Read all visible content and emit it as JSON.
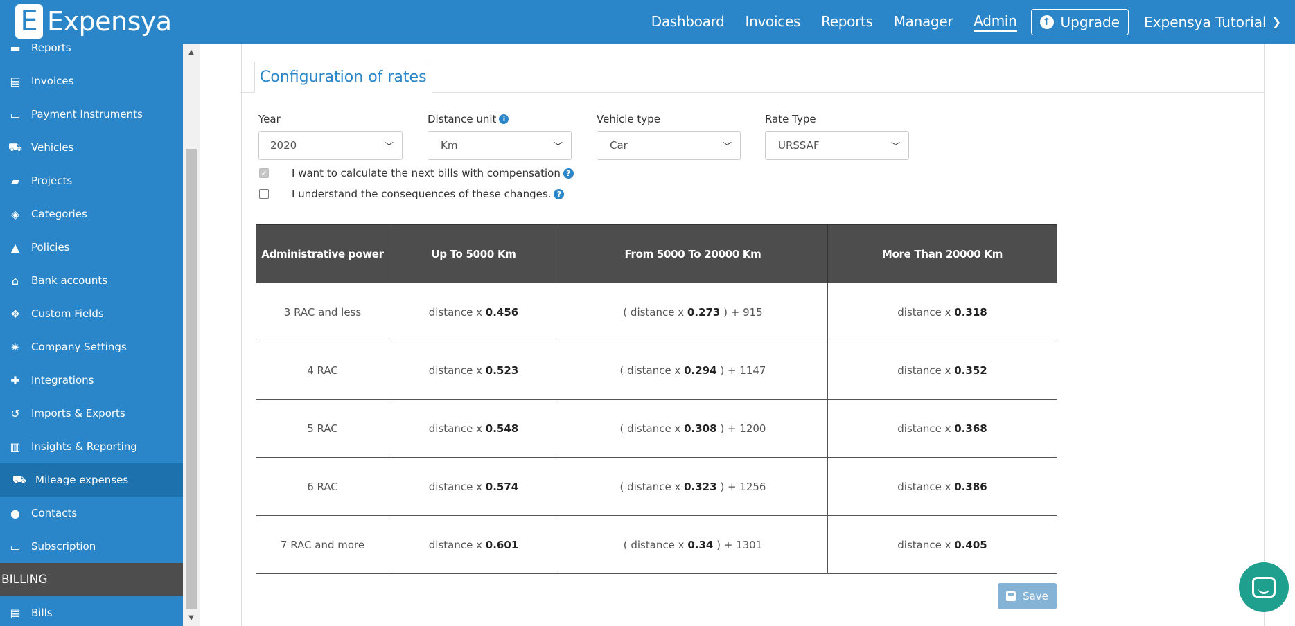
{
  "brand": {
    "logo_letter": "E",
    "name": "Expensya"
  },
  "nav": {
    "items": [
      {
        "label": "Dashboard",
        "active": false
      },
      {
        "label": "Invoices",
        "active": false
      },
      {
        "label": "Reports",
        "active": false
      },
      {
        "label": "Manager",
        "active": false
      },
      {
        "label": "Admin",
        "active": true
      }
    ],
    "upgrade_label": "Upgrade",
    "user_label": "Expensya Tutorial"
  },
  "sidebar": {
    "items": [
      {
        "label": "Reports",
        "icon": "card-icon"
      },
      {
        "label": "Invoices",
        "icon": "file-icon"
      },
      {
        "label": "Payment Instruments",
        "icon": "credit-card-icon"
      },
      {
        "label": "Vehicles",
        "icon": "car-icon"
      },
      {
        "label": "Projects",
        "icon": "book-icon"
      },
      {
        "label": "Categories",
        "icon": "tags-icon"
      },
      {
        "label": "Policies",
        "icon": "warning-icon"
      },
      {
        "label": "Bank accounts",
        "icon": "bank-icon"
      },
      {
        "label": "Custom Fields",
        "icon": "cubes-icon"
      },
      {
        "label": "Company Settings",
        "icon": "gears-icon"
      },
      {
        "label": "Integrations",
        "icon": "puzzle-icon"
      },
      {
        "label": "Imports & Exports",
        "icon": "history-icon"
      },
      {
        "label": "Insights & Reporting",
        "icon": "bar-chart-icon"
      },
      {
        "label": "Mileage expenses",
        "icon": "car-icon",
        "active": true
      },
      {
        "label": "Contacts",
        "icon": "user-icon"
      },
      {
        "label": "Subscription",
        "icon": "credit-card-icon"
      }
    ],
    "section_billing": "BILLING",
    "billing_items": [
      {
        "label": "Bills",
        "icon": "file-icon"
      }
    ]
  },
  "main": {
    "tab_title": "Configuration of rates",
    "filters": {
      "year": {
        "label": "Year",
        "value": "2020"
      },
      "distance_unit": {
        "label": "Distance unit",
        "value": "Km"
      },
      "vehicle_type": {
        "label": "Vehicle type",
        "value": "Car"
      },
      "rate_type": {
        "label": "Rate Type",
        "value": "URSSAF"
      }
    },
    "checkboxes": {
      "compensation": {
        "label": "I want to calculate the next bills with compensation",
        "checked": true
      },
      "consequences": {
        "label": "I understand the consequences of these changes.",
        "checked": false
      }
    },
    "table": {
      "headers": [
        "Administrative power",
        "Up To 5000 Km",
        "From 5000 To 20000 Km",
        "More Than 20000 Km"
      ],
      "rows": [
        {
          "power": "3 RAC and less",
          "up_prefix": "distance x ",
          "up_val": "0.456",
          "mid_prefix": "( distance x ",
          "mid_val": "0.273",
          "mid_suffix": " ) + 915",
          "more_prefix": "distance x ",
          "more_val": "0.318"
        },
        {
          "power": "4 RAC",
          "up_prefix": "distance x ",
          "up_val": "0.523",
          "mid_prefix": "( distance x ",
          "mid_val": "0.294",
          "mid_suffix": " ) + 1147",
          "more_prefix": "distance x ",
          "more_val": "0.352"
        },
        {
          "power": "5 RAC",
          "up_prefix": "distance x ",
          "up_val": "0.548",
          "mid_prefix": "( distance x ",
          "mid_val": "0.308",
          "mid_suffix": " ) + 1200",
          "more_prefix": "distance x ",
          "more_val": "0.368"
        },
        {
          "power": "6 RAC",
          "up_prefix": "distance x ",
          "up_val": "0.574",
          "mid_prefix": "( distance x ",
          "mid_val": "0.323",
          "mid_suffix": " ) + 1256",
          "more_prefix": "distance x ",
          "more_val": "0.386"
        },
        {
          "power": "7 RAC and more",
          "up_prefix": "distance x ",
          "up_val": "0.601",
          "mid_prefix": "( distance x ",
          "mid_val": "0.34",
          "mid_suffix": " ) + 1301",
          "more_prefix": "distance x ",
          "more_val": "0.405"
        }
      ]
    },
    "save_label": "Save"
  },
  "colors": {
    "brand_blue": "#2a86c9",
    "sidebar_active": "#1d72ae",
    "table_header": "#4d4d4d",
    "save_disabled": "#85b3d6",
    "chat": "#1fa08f"
  }
}
